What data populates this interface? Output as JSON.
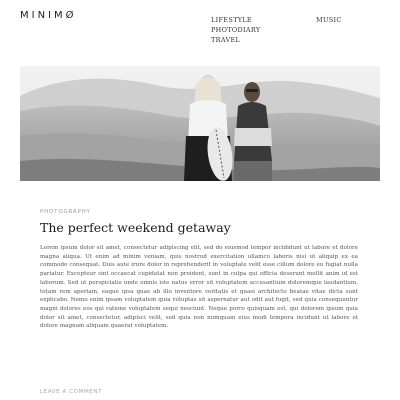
{
  "site": {
    "logo": "MINIMØ"
  },
  "nav": {
    "column1": [
      "LIFESTYLE",
      "PHOTODIARY",
      "TRAVEL"
    ],
    "column2": [
      "MUSIC"
    ]
  },
  "post": {
    "category": "PHOTOGRAPHY",
    "title": "The perfect weekend getaway",
    "body": "Lorem ipsum dolor sit amet, consectetur adipiscing elit, sed do eiusmod tempor incididunt ut labore et dolore magna aliqua. Ut enim ad minim veniam, quis nostrud exercitation ullamco laboris nisi ut aliquip ex ea commodo consequat. Duis aute irure dolor in reprehenderit in voluptate velit esse cillum dolore eu fugiat nulla pariatur. Excepteur sint occaecat cupidatat non proident, sunt in culpa qui officia deserunt mollit anim id est laborum. Sed ut perspiciatis unde omnis iste natus error sit voluptatem accusantium doloremque laudantium, totam rem aperiam, eaque ipsa quae ab illo inventore veritatis et quasi architecto beatae vitae dicta sunt explicabo. Nemo enim ipsam voluptatem quia voluptas sit aspernatur aut odit aut fugit, sed quia consequuntur magni dolores eos qui ratione voluptatem sequi nesciunt. Neque porro quisquam est, qui dolorem ipsum quia dolor sit amet, consectetur, adipisci velit, sed quia non numquam eius modi tempora incidunt ut labore et dolore magnam aliquam quaerat voluptatem.",
    "comment_link": "LEAVE A COMMENT"
  }
}
